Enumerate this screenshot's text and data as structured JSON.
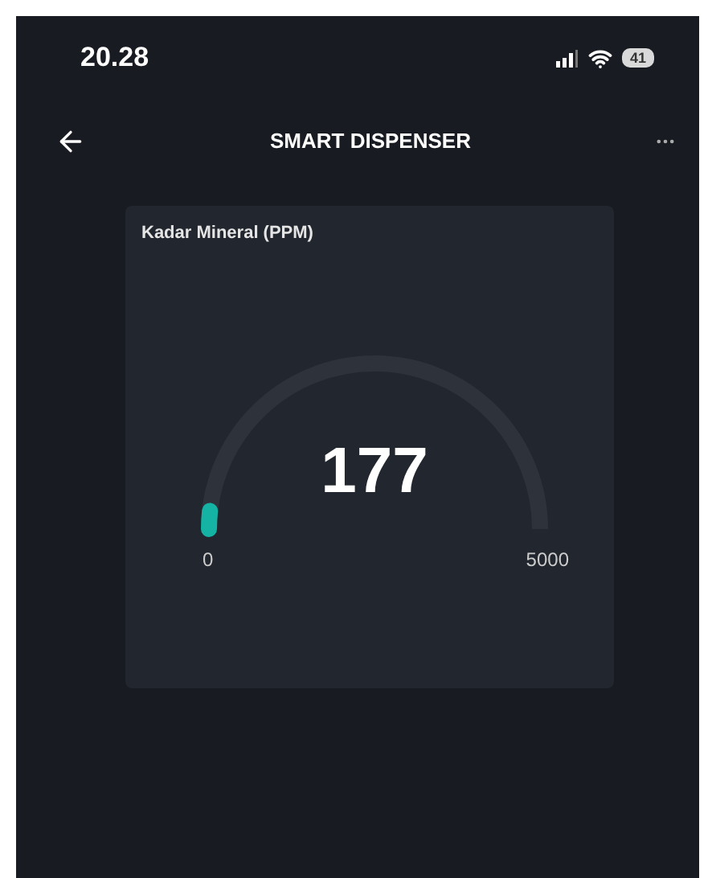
{
  "status_bar": {
    "time": "20.28",
    "battery": "41"
  },
  "header": {
    "title": "SMART DISPENSER"
  },
  "card": {
    "title": "Kadar Mineral (PPM)",
    "gauge": {
      "value": "177",
      "min_label": "0",
      "max_label": "5000"
    }
  }
}
